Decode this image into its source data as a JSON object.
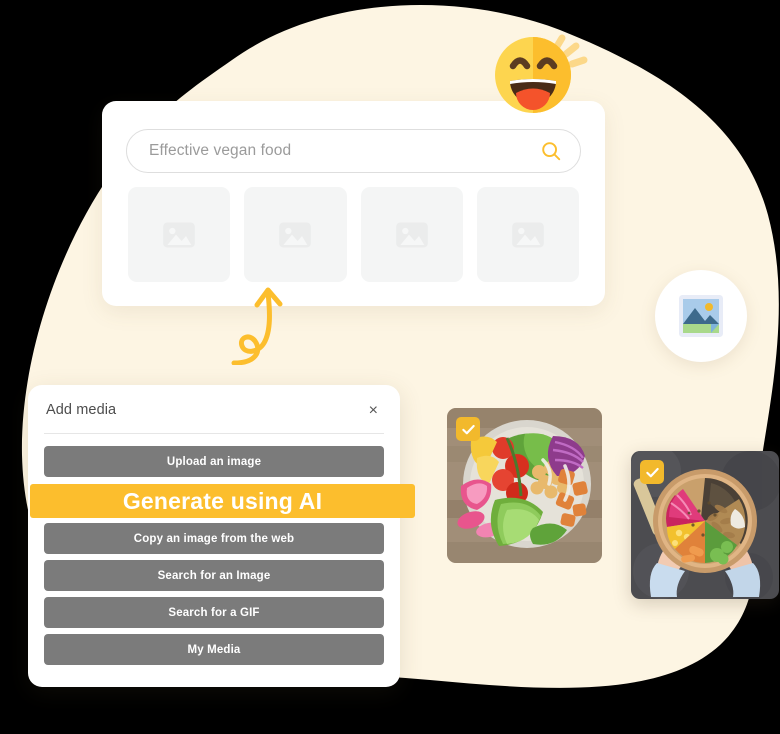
{
  "colors": {
    "blob_cream": "#FDF5E3",
    "accent_amber": "#FCBE2D",
    "button_gray": "#7B7B7B",
    "placeholder_gray": "#F4F5F5",
    "page_background": "#000000",
    "card_white": "#FFFFFF",
    "search_text_gray": "#9B9B9B"
  },
  "search_card": {
    "search": {
      "value": "Effective vegan food",
      "placeholder": "Effective vegan food",
      "icon": "search-icon"
    },
    "thumbnails": [
      {
        "icon": "image-placeholder-icon",
        "label": ""
      },
      {
        "icon": "image-placeholder-icon",
        "label": ""
      },
      {
        "icon": "image-placeholder-icon",
        "label": ""
      },
      {
        "icon": "image-placeholder-icon",
        "label": ""
      }
    ]
  },
  "decorations": {
    "emoji": "grinning-face-with-smiling-eyes-emoji",
    "image_badge": "picture-icon",
    "arrow": "curly-up-arrow-icon"
  },
  "media_panel": {
    "title": "Add media",
    "close_label": "×",
    "buttons": [
      {
        "label": "Upload an image",
        "highlighted": false
      },
      {
        "label": "Generate using AI",
        "highlighted": true
      },
      {
        "label": "Copy an image from the web",
        "highlighted": false
      },
      {
        "label": "Search for an Image",
        "highlighted": false
      },
      {
        "label": "Search for a GIF",
        "highlighted": false
      },
      {
        "label": "My Media",
        "highlighted": false
      }
    ]
  },
  "photos": [
    {
      "name": "vegan-buddha-bowl-photo",
      "selected": true,
      "check_icon": "check-icon"
    },
    {
      "name": "hands-holding-grain-bowl-photo",
      "selected": true,
      "check_icon": "check-icon"
    }
  ]
}
